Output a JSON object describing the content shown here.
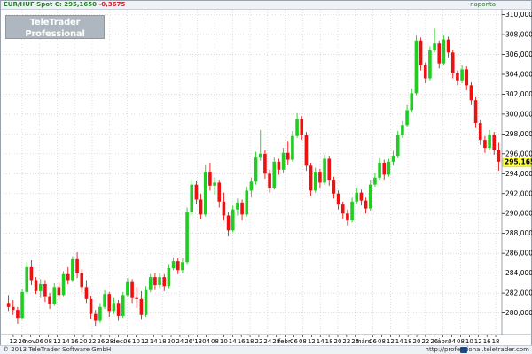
{
  "header": {
    "instrument": "EUR/HUF Spot",
    "close_label": "C:",
    "close_value": "295,1650",
    "change": "-0,3675",
    "timeframe": "naponta"
  },
  "watermark": {
    "title": "TeleTrader Professional",
    "url": "http://professional.teletrader.com/"
  },
  "footer": {
    "copyright": "© 2013 TeleTrader Software GmbH",
    "url": "http://professional.teletrader.com"
  },
  "colors": {
    "up": "#22cc22",
    "down": "#ee1111",
    "last_price_bg": "#ffff33",
    "accent": "#2e7d32"
  },
  "chart_data": {
    "type": "candlestick",
    "title": "EUR/HUF Spot",
    "ylim": [
      278,
      310.5
    ],
    "y_ticks": [
      "280,0000",
      "282,0000",
      "284,0000",
      "286,0000",
      "288,0000",
      "290,0000",
      "292,0000",
      "294,0000",
      "296,0000",
      "298,0000",
      "300,0000",
      "302,0000",
      "304,0000",
      "306,0000",
      "308,0000",
      "310,0000"
    ],
    "x_labels": [
      "12",
      "26",
      "nov.",
      "06",
      "08",
      "12",
      "14",
      "16",
      "20",
      "22",
      "26",
      "28",
      "dec.",
      "06",
      "10",
      "12",
      "14",
      "18",
      "20",
      "24",
      "26",
      "'13",
      "04",
      "08",
      "10",
      "14",
      "16",
      "18",
      "22",
      "24",
      "28",
      "febr.",
      "06",
      "08",
      "12",
      "14",
      "18",
      "20",
      "22",
      "26",
      "márc.",
      "06",
      "08",
      "12",
      "14",
      "18",
      "20",
      "22",
      "26",
      "ápr.",
      "04",
      "08",
      "10",
      "12",
      "16",
      "18"
    ],
    "last_price": "295,1650",
    "grid": true,
    "ohlc": [
      [
        281.0,
        281.8,
        280.2,
        280.6
      ],
      [
        280.6,
        281.3,
        279.8,
        280.3
      ],
      [
        280.3,
        280.6,
        278.9,
        279.5
      ],
      [
        279.5,
        282.4,
        279.3,
        282.1
      ],
      [
        282.1,
        285.1,
        281.9,
        284.6
      ],
      [
        284.6,
        285.3,
        282.8,
        283.3
      ],
      [
        283.3,
        283.6,
        281.9,
        282.2
      ],
      [
        282.2,
        283.4,
        281.5,
        282.9
      ],
      [
        282.9,
        283.3,
        281.1,
        281.6
      ],
      [
        281.6,
        282.0,
        280.4,
        280.9
      ],
      [
        280.9,
        283.0,
        280.7,
        282.6
      ],
      [
        282.6,
        283.1,
        281.4,
        281.8
      ],
      [
        281.8,
        284.2,
        281.6,
        283.9
      ],
      [
        283.9,
        284.6,
        282.9,
        283.3
      ],
      [
        283.3,
        285.7,
        283.1,
        285.4
      ],
      [
        285.4,
        286.1,
        283.5,
        284.0
      ],
      [
        284.0,
        284.4,
        282.1,
        282.6
      ],
      [
        282.6,
        283.3,
        281.0,
        281.4
      ],
      [
        281.4,
        281.7,
        279.4,
        279.9
      ],
      [
        279.9,
        280.3,
        278.7,
        279.2
      ],
      [
        279.2,
        281.0,
        279.0,
        280.6
      ],
      [
        280.6,
        282.3,
        280.4,
        281.9
      ],
      [
        281.9,
        282.1,
        279.6,
        280.2
      ],
      [
        280.2,
        281.5,
        279.9,
        281.0
      ],
      [
        281.0,
        281.3,
        279.2,
        279.7
      ],
      [
        279.7,
        282.1,
        279.5,
        281.8
      ],
      [
        281.8,
        283.5,
        281.6,
        283.1
      ],
      [
        283.1,
        283.4,
        281.0,
        281.5
      ],
      [
        281.5,
        282.6,
        280.5,
        281.4
      ],
      [
        281.4,
        282.2,
        279.3,
        279.8
      ],
      [
        279.8,
        282.7,
        279.6,
        282.3
      ],
      [
        282.3,
        283.9,
        282.1,
        283.6
      ],
      [
        283.6,
        284.0,
        282.3,
        282.8
      ],
      [
        282.8,
        284.0,
        282.5,
        283.6
      ],
      [
        283.6,
        283.9,
        282.2,
        282.7
      ],
      [
        282.7,
        284.9,
        282.5,
        284.5
      ],
      [
        284.5,
        285.6,
        284.3,
        285.2
      ],
      [
        285.2,
        285.5,
        283.9,
        284.3
      ],
      [
        284.3,
        285.5,
        284.0,
        285.1
      ],
      [
        285.1,
        290.6,
        284.9,
        290.1
      ],
      [
        290.1,
        293.4,
        289.8,
        292.9
      ],
      [
        292.9,
        293.3,
        290.9,
        291.4
      ],
      [
        291.4,
        292.0,
        289.4,
        289.9
      ],
      [
        289.9,
        294.9,
        289.7,
        294.2
      ],
      [
        294.2,
        295.1,
        292.3,
        292.8
      ],
      [
        292.8,
        293.6,
        291.9,
        293.1
      ],
      [
        293.1,
        293.4,
        290.6,
        291.2
      ],
      [
        291.2,
        292.1,
        289.3,
        289.8
      ],
      [
        289.8,
        290.1,
        287.7,
        288.3
      ],
      [
        288.3,
        290.8,
        288.1,
        290.4
      ],
      [
        290.4,
        291.5,
        289.8,
        291.1
      ],
      [
        291.1,
        291.4,
        289.3,
        289.9
      ],
      [
        289.9,
        292.7,
        289.7,
        292.3
      ],
      [
        292.3,
        293.6,
        291.6,
        293.2
      ],
      [
        293.2,
        296.2,
        292.9,
        295.7
      ],
      [
        295.7,
        298.4,
        295.3,
        296.0
      ],
      [
        296.0,
        296.4,
        293.5,
        294.0
      ],
      [
        294.0,
        294.4,
        292.1,
        292.6
      ],
      [
        292.6,
        295.7,
        292.4,
        295.2
      ],
      [
        295.2,
        295.5,
        293.9,
        294.4
      ],
      [
        294.4,
        296.6,
        294.1,
        296.1
      ],
      [
        296.1,
        297.3,
        294.9,
        295.4
      ],
      [
        295.4,
        298.3,
        295.2,
        297.8
      ],
      [
        297.8,
        300.1,
        297.6,
        299.5
      ],
      [
        299.5,
        299.8,
        297.4,
        297.9
      ],
      [
        297.9,
        298.2,
        294.3,
        294.8
      ],
      [
        294.8,
        295.1,
        291.8,
        292.3
      ],
      [
        292.3,
        294.6,
        292.1,
        294.2
      ],
      [
        294.2,
        294.5,
        292.6,
        293.1
      ],
      [
        293.1,
        295.9,
        292.9,
        295.5
      ],
      [
        295.5,
        295.8,
        292.8,
        293.4
      ],
      [
        293.4,
        293.7,
        291.5,
        292.0
      ],
      [
        292.0,
        292.3,
        290.4,
        290.9
      ],
      [
        290.9,
        291.2,
        289.5,
        290.0
      ],
      [
        290.0,
        290.4,
        288.8,
        289.3
      ],
      [
        289.3,
        291.6,
        289.1,
        291.2
      ],
      [
        291.2,
        292.6,
        291.0,
        292.1
      ],
      [
        292.1,
        292.4,
        290.8,
        291.3
      ],
      [
        291.3,
        291.6,
        290.0,
        290.5
      ],
      [
        290.5,
        293.4,
        290.3,
        292.9
      ],
      [
        292.9,
        294.1,
        292.7,
        293.6
      ],
      [
        293.6,
        295.6,
        293.4,
        295.1
      ],
      [
        295.1,
        295.4,
        293.4,
        293.9
      ],
      [
        293.9,
        295.5,
        293.7,
        295.2
      ],
      [
        295.2,
        296.3,
        294.8,
        295.8
      ],
      [
        295.8,
        298.3,
        295.6,
        297.9
      ],
      [
        297.9,
        299.3,
        297.6,
        298.9
      ],
      [
        298.9,
        300.9,
        298.7,
        300.4
      ],
      [
        300.4,
        302.6,
        300.2,
        302.1
      ],
      [
        302.1,
        307.9,
        301.9,
        307.4
      ],
      [
        307.4,
        307.7,
        304.4,
        304.9
      ],
      [
        304.9,
        305.2,
        303.1,
        303.6
      ],
      [
        303.6,
        306.8,
        303.4,
        306.4
      ],
      [
        306.4,
        308.6,
        306.2,
        307.1
      ],
      [
        307.1,
        307.4,
        304.6,
        305.1
      ],
      [
        305.1,
        307.9,
        304.9,
        307.5
      ],
      [
        307.5,
        307.8,
        305.7,
        306.2
      ],
      [
        306.2,
        306.5,
        303.6,
        304.1
      ],
      [
        304.1,
        304.4,
        302.9,
        303.4
      ],
      [
        303.4,
        304.9,
        303.1,
        304.5
      ],
      [
        304.5,
        304.8,
        302.4,
        302.9
      ],
      [
        302.9,
        303.2,
        300.9,
        301.4
      ],
      [
        301.4,
        301.7,
        298.6,
        299.1
      ],
      [
        299.1,
        299.4,
        296.9,
        297.4
      ],
      [
        297.4,
        297.8,
        296.1,
        296.6
      ],
      [
        296.6,
        298.4,
        296.4,
        297.9
      ],
      [
        297.9,
        298.2,
        295.9,
        296.4
      ],
      [
        296.4,
        297.1,
        294.3,
        295.2
      ]
    ]
  }
}
